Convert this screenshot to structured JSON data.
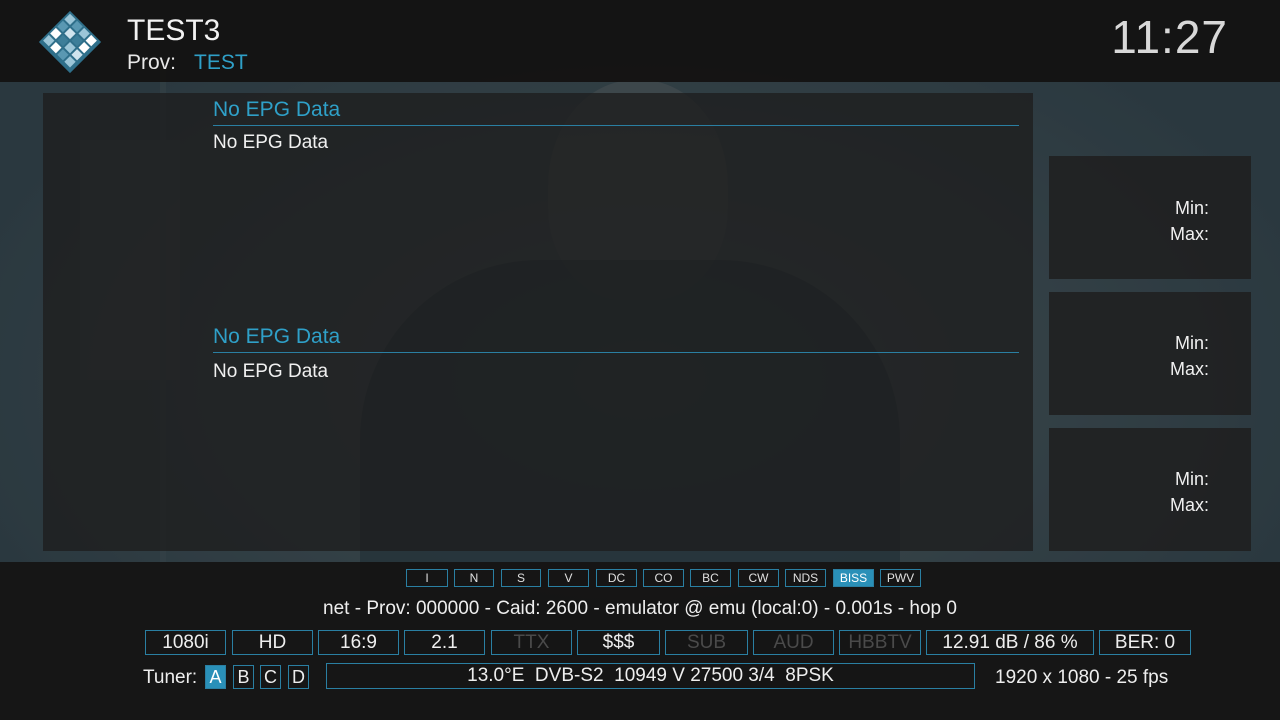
{
  "header": {
    "channel_name": "TEST3",
    "prov_label": "Prov:",
    "prov_value": "TEST",
    "clock": "11:27",
    "logo_icon": "enigma-tile-logo-icon"
  },
  "epg": {
    "now_title": "No EPG Data",
    "now_description": "No EPG Data",
    "next_title": "No EPG Data",
    "next_description": "No EPG Data"
  },
  "side_panels": [
    {
      "min_label": "Min:",
      "max_label": "Max:"
    },
    {
      "min_label": "Min:",
      "max_label": "Max:"
    },
    {
      "min_label": "Min:",
      "max_label": "Max:"
    }
  ],
  "cas_flags": [
    {
      "label": "I",
      "active": false
    },
    {
      "label": "N",
      "active": false
    },
    {
      "label": "S",
      "active": false
    },
    {
      "label": "V",
      "active": false
    },
    {
      "label": "DC",
      "active": false
    },
    {
      "label": "CO",
      "active": false
    },
    {
      "label": "BC",
      "active": false
    },
    {
      "label": "CW",
      "active": false
    },
    {
      "label": "NDS",
      "active": false
    },
    {
      "label": "BISS",
      "active": true
    },
    {
      "label": "PWV",
      "active": false
    }
  ],
  "ecm_info": "net - Prov: 000000 - Caid: 2600 - emulator @ emu (local:0) - 0.001s - hop 0",
  "info_boxes": [
    {
      "label": "1080i",
      "dim": false
    },
    {
      "label": "HD",
      "dim": false
    },
    {
      "label": "16:9",
      "dim": false
    },
    {
      "label": "2.1",
      "dim": false
    },
    {
      "label": "TTX",
      "dim": true
    },
    {
      "label": "$$$",
      "dim": false
    },
    {
      "label": "SUB",
      "dim": true
    },
    {
      "label": "AUD",
      "dim": true
    },
    {
      "label": "HBBTV",
      "dim": true
    },
    {
      "label": "12.91 dB / 86 %",
      "dim": false
    },
    {
      "label": "BER: 0",
      "dim": false
    }
  ],
  "tuner": {
    "label": "Tuner:",
    "slots": [
      {
        "label": "A",
        "active": true
      },
      {
        "label": "B",
        "active": false
      },
      {
        "label": "C",
        "active": false
      },
      {
        "label": "D",
        "active": false
      }
    ]
  },
  "transponder": "13.0°E  DVB-S2  10949 V 27500 3/4  8PSK",
  "resolution": "1920 x 1080 - 25 fps",
  "colors": {
    "accent": "#2fa0c8",
    "border": "#2a7fa2",
    "active_bg": "#2a90b8"
  }
}
